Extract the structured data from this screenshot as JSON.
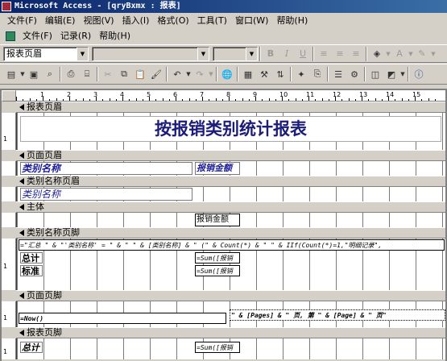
{
  "window": {
    "title": "Microsoft Access - [qryBxmx : 报表]"
  },
  "menu_main": [
    "文件(F)",
    "编辑(E)",
    "视图(V)",
    "插入(I)",
    "格式(O)",
    "工具(T)",
    "窗口(W)",
    "帮助(H)"
  ],
  "menu_sub": [
    "文件(F)",
    "记录(R)",
    "帮助(H)"
  ],
  "formatting": {
    "object_selector": "报表页眉",
    "font_name": "",
    "font_size": "",
    "bold": "B",
    "italic": "I",
    "underline": "U"
  },
  "ruler": {
    "h_numbers": [
      "1",
      "2",
      "3",
      "4",
      "5",
      "6",
      "7",
      "8",
      "9",
      "10",
      "11",
      "12",
      "13",
      "14",
      "15"
    ],
    "v_numbers": [
      "1",
      "1",
      "1",
      "1"
    ]
  },
  "sections": {
    "report_header": {
      "label": "报表页眉",
      "title": "按报销类别统计报表"
    },
    "page_header": {
      "label": "页面页眉",
      "col1": "类别名称",
      "col2": "报销金额"
    },
    "group_header": {
      "label": "类别名称页眉",
      "field": "类别名称"
    },
    "detail": {
      "label": "主体",
      "field": "报销金额"
    },
    "group_footer": {
      "label": "类别名称页脚",
      "expr": "=\"汇总 \" & \"'类别名称' = \" & \" \" & [类别名称] & \" (\" & Count(*) & \" \" & IIf(Count(*)=1,\"明细记录\",",
      "total_label": "总计",
      "total_expr": "=Sum([报销",
      "std_label": "标准",
      "std_expr": "=Sum([报销"
    },
    "page_footer": {
      "label": "页面页脚",
      "now_expr": "=Now()",
      "page_expr": "\" & [Pages] & \" 页, 第 \" & [Page] & \" 页\""
    },
    "report_footer": {
      "label": "报表页脚",
      "total_label": "总计",
      "sum_expr": "=Sum([报销"
    }
  }
}
